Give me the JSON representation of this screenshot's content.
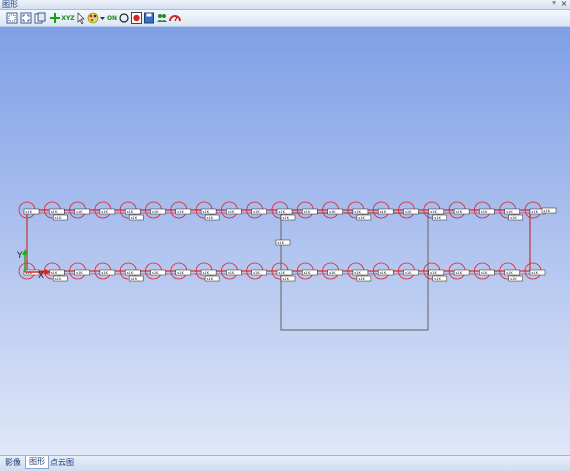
{
  "window": {
    "title": "图形",
    "pin_glyph": "ᵠ",
    "close_glyph": "×"
  },
  "toolbar": {
    "tools": [
      {
        "name": "select-frame-icon"
      },
      {
        "name": "zoom-extents-icon"
      },
      {
        "name": "copy-view-icon"
      },
      {
        "name": "add-point-icon"
      },
      {
        "name": "xyz-label",
        "label": "XYZ"
      },
      {
        "name": "pan-cursor-icon"
      },
      {
        "name": "color-palette-icon"
      },
      {
        "name": "dropdown-arrow-icon"
      },
      {
        "name": "on-toggle",
        "label": "ON"
      },
      {
        "name": "circle-icon"
      },
      {
        "name": "record-icon"
      },
      {
        "name": "save-icon"
      },
      {
        "name": "survey-users-icon"
      },
      {
        "name": "gauge-icon"
      }
    ]
  },
  "canvas": {
    "axis_y_label": "Y",
    "axis_x_label": "X",
    "colors": {
      "track": "#cc1111",
      "circle": "#dd2222",
      "box": "#7a7a7a",
      "axis_y": "#22aa22",
      "axis_x": "#dd2222"
    },
    "small_label_text": "s1K"
  },
  "status_tabs": [
    {
      "label": "影像",
      "active": false
    },
    {
      "label": "图形",
      "active": true
    },
    {
      "label": "点云图",
      "active": false
    }
  ]
}
